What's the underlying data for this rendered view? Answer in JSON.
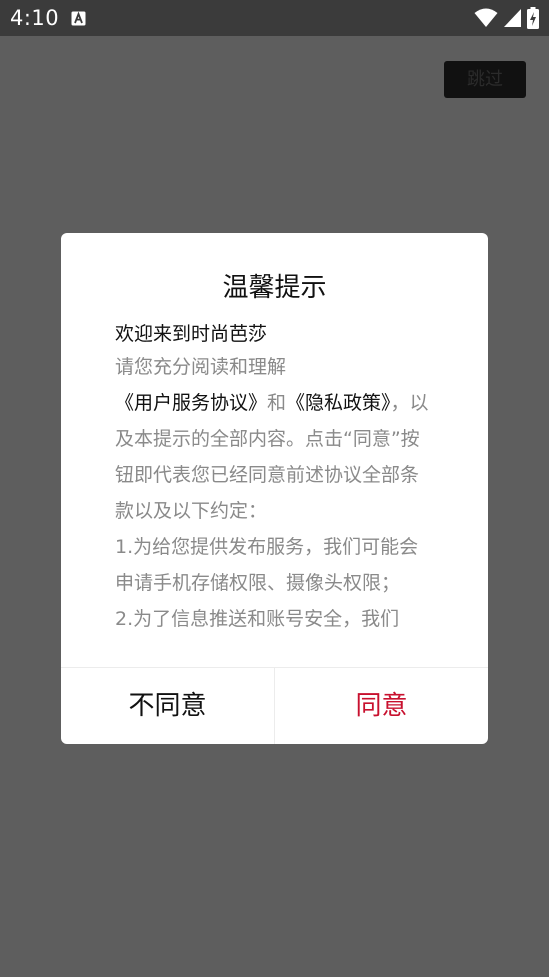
{
  "status_bar": {
    "time": "4:10",
    "icons": [
      "text-a-icon",
      "wifi-icon",
      "signal-icon",
      "battery-charging-icon"
    ]
  },
  "skip": {
    "label": "跳过"
  },
  "dialog": {
    "title": "温馨提示",
    "welcome": "欢迎来到时尚芭莎",
    "agreement": {
      "intro": "请您充分阅读和理解",
      "user_agreement_link": "《用户服务协议》",
      "conj": "和",
      "privacy_link": "《隐私政策》",
      "rest": "，以及本提示的全部内容。点击“同意”按钮即代表您已经同意前述协议全部条款以及以下约定：",
      "item1": "1.为给您提供发布服务，我们可能会申请手机存储权限、摄像头权限；",
      "item2": "2.为了信息推送和账号安全，我们"
    },
    "disagree_label": "不同意",
    "agree_label": "同意"
  },
  "colors": {
    "overlay": "#5e5e5e",
    "status_bar": "#3b3b3b",
    "accent": "#c8102e",
    "muted_text": "#8a8a8a"
  }
}
